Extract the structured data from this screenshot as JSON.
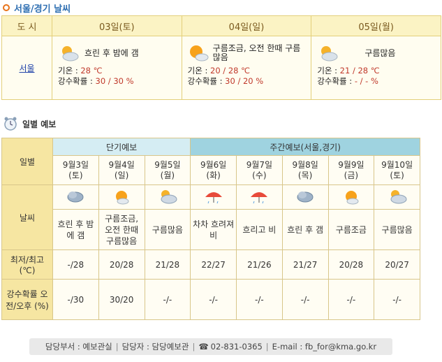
{
  "title": "서울/경기 날씨",
  "top_table": {
    "city_header": "도 시",
    "city_name": "서울",
    "days": [
      {
        "date": "03일(토)",
        "condition": "흐린 후 밤에 갬",
        "icon": "cloud-sun-icon",
        "temp_label": "기온 : ",
        "temp_val": "28 ℃",
        "rain_label": "강수확률 : ",
        "rain_val": "30 / 30 %"
      },
      {
        "date": "04일(일)",
        "condition": "구름조금, 오전 한때 구름많음",
        "icon": "sun-cloud-icon",
        "temp_label": "기온 : ",
        "temp_val": "20 / 28 ℃",
        "rain_label": "강수확률 : ",
        "rain_val": "30 / 20 %"
      },
      {
        "date": "05일(월)",
        "condition": "구름많음",
        "icon": "cloud-sun-icon",
        "temp_label": "기온 : ",
        "temp_val": "21 / 28 ℃",
        "rain_label": "강수확률 : ",
        "rain_val": "- / - %"
      }
    ]
  },
  "daily": {
    "title": "일별 예보",
    "short_term": "단기예보",
    "weekly": "주간예보(서울,경기)",
    "row_labels": {
      "date": "일별",
      "weather": "날씨",
      "temp": "최저/최고 (℃)",
      "rain": "강수확률 오전/오후 (%)"
    },
    "columns": [
      {
        "date": "9월3일",
        "dow": "(토)",
        "icon": "cloudy-icon",
        "cond": "흐린 후 밤에 갬",
        "temp": "-/28",
        "rain": "-/30"
      },
      {
        "date": "9월4일",
        "dow": "(일)",
        "icon": "sun-cloud-icon",
        "cond": "구름조금, 오전 한때 구름많음",
        "temp": "20/28",
        "rain": "30/20"
      },
      {
        "date": "9월5일",
        "dow": "(월)",
        "icon": "cloud-sun-icon",
        "cond": "구름많음",
        "temp": "21/28",
        "rain": "-/-"
      },
      {
        "date": "9월6일",
        "dow": "(화)",
        "icon": "umbrella-icon",
        "cond": "차차 흐려져 비",
        "temp": "22/27",
        "rain": "-/-"
      },
      {
        "date": "9월7일",
        "dow": "(수)",
        "icon": "umbrella-icon",
        "cond": "흐리고 비",
        "temp": "21/26",
        "rain": "-/-"
      },
      {
        "date": "9월8일",
        "dow": "(목)",
        "icon": "cloudy-icon",
        "cond": "흐린 후 갬",
        "temp": "21/27",
        "rain": "-/-"
      },
      {
        "date": "9월9일",
        "dow": "(금)",
        "icon": "sun-cloud-icon",
        "cond": "구름조금",
        "temp": "20/28",
        "rain": "-/-"
      },
      {
        "date": "9월10일",
        "dow": "(토)",
        "icon": "cloud-sun-icon",
        "cond": "구름많음",
        "temp": "20/27",
        "rain": "-/-"
      }
    ]
  },
  "footer": {
    "dept": "담당부서 : 예보관실",
    "person": "담당자 : 담당예보관",
    "phone": "02-831-0365",
    "email": "E-mail : fb_for@kma.go.kr"
  }
}
